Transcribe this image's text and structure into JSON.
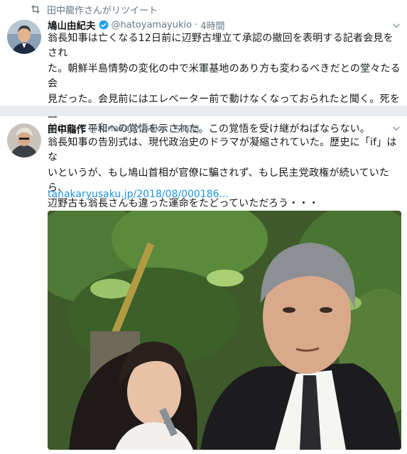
{
  "retweet_context": {
    "text": "田中龍作さんがリツイート",
    "icon": "retweet-icon"
  },
  "tweets": [
    {
      "name": "鳩山由紀夫",
      "verified": true,
      "handle": "@hatoyamayukio",
      "separator": "·",
      "time": "4時間",
      "lines": [
        "翁長知事は亡くなる12日前に辺野古埋立て承認の撤回を表明する記者会見をされ",
        "た。朝鮮半島情勢の変化の中で米軍基地のあり方も変わるべきだとの堂々たる会",
        "見だった。会見前にはエレベーター前で動けなくなっておられたと聞く。死を直",
        "前にして平和への覚悟を示された。この覚悟を受け継がねばならない。"
      ]
    },
    {
      "name": "田中龍作",
      "verified": false,
      "handle": "@tanakaryusaku",
      "separator": "·",
      "time": "5時間",
      "lines": [
        "翁長知事の告別式は、現代政治史のドラマが凝縮されていた。歴史に「if」はな",
        "いというが、もし鳩山首相が官僚に騙されず、もし民主党政権が続いていたら、",
        "辺野古も翁長さんも違った運命をたどっていただろう・・・"
      ],
      "link": "tanakaryusaku.jp/2018/08/000186..."
    }
  ],
  "icons": {
    "more": "chevron-down-icon",
    "verified": "verified-badge-icon"
  },
  "colors": {
    "link": "#1b95e0",
    "verified": "#1da1f2",
    "muted": "#657786",
    "divider": "#e6ecf0"
  }
}
